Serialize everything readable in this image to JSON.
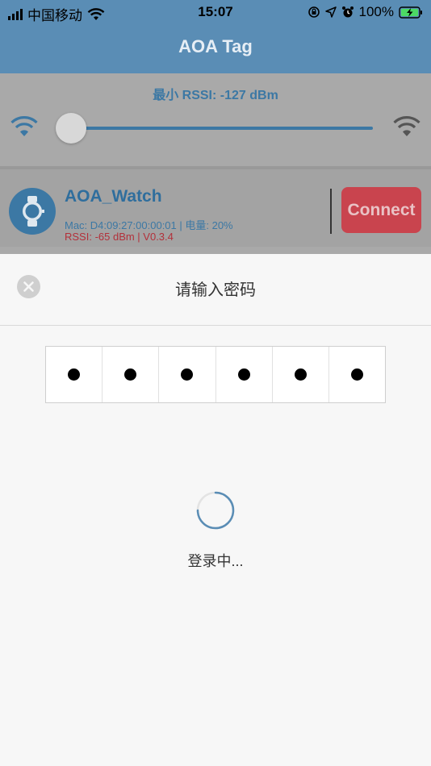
{
  "status_bar": {
    "carrier": "中国移动",
    "time": "15:07",
    "battery": "100%"
  },
  "nav": {
    "title": "AOA Tag"
  },
  "filter": {
    "min_rssi_label": "最小 RSSI: -127 dBm",
    "slider_value": 0
  },
  "device": {
    "name": "AOA_Watch",
    "mac_line": "Mac: D4:09:27:00:00:01 | 电量: 20%",
    "rssi_line": "RSSI: -65 dBm | V0.3.4",
    "connect_label": "Connect"
  },
  "password_sheet": {
    "title": "请输入密码",
    "pin_dots": 6,
    "loading_text": "登录中..."
  },
  "colors": {
    "nav_blue": "#5a8db5",
    "accent_blue": "#3c78a4",
    "connect_red": "#c9444e",
    "rssi_red": "#b3303a"
  },
  "icons": [
    "signal-bars-icon",
    "wifi-icon",
    "orientation-lock-icon",
    "location-arrow-icon",
    "alarm-icon",
    "battery-charging-icon",
    "watch-icon",
    "close-icon",
    "spinner-icon"
  ]
}
